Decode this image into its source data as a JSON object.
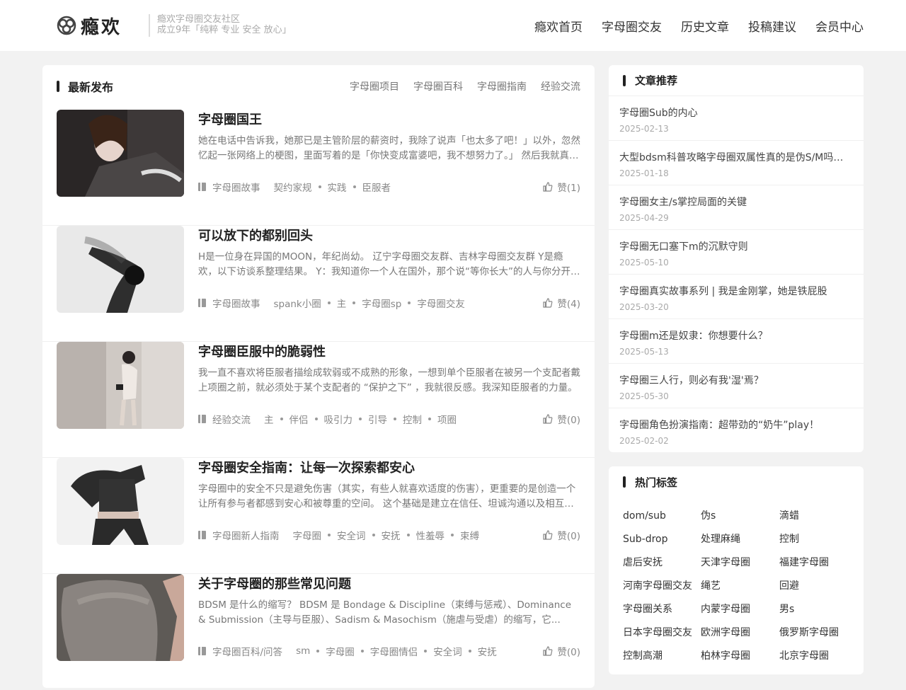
{
  "header": {
    "logo_text": "瘾欢",
    "tagline_line1": "瘾欢字母圈交友社区",
    "tagline_line2": "成立9年「纯粹 专业 安全 放心」",
    "nav": [
      "瘾欢首页",
      "字母圈交友",
      "历史文章",
      "投稿建议",
      "会员中心"
    ]
  },
  "latest": {
    "title": "最新发布",
    "tabs": [
      "字母圈项目",
      "字母圈百科",
      "字母圈指南",
      "经验交流"
    ],
    "posts": [
      {
        "title": "字母圈国王",
        "desc": "她在电话中告诉我，她那已是主管阶层的薪资时，我除了说声「也太多了吧！」以外，忽然忆起一张网络上的梗图，里面写着的是「你快变成富婆吧，我不想努力了。」 然后我就真的觉得自己可以不用努力了。",
        "category": "字母圈故事",
        "tags": [
          "契约家规",
          "实践",
          "臣服者"
        ],
        "likes": "赞(1)"
      },
      {
        "title": "可以放下的都别回头",
        "desc": "H是一位身在异国的MOON，年纪尚幼。 辽宁字母圈交友群、吉林字母圈交友群 Y是瘾欢，以下访谈系整理结果。 Y：我知道你一个人在国外，那个说“等你长大”的人与你分开了。",
        "category": "字母圈故事",
        "tags": [
          "spank小圈",
          "主",
          "字母圈sp",
          "字母圈交友"
        ],
        "likes": "赞(4)"
      },
      {
        "title": "字母圈臣服中的脆弱性",
        "desc": "我一直不喜欢将臣服者描绘成软弱或不成熟的形象，一想到单个臣服者在被另一个支配者戴上项圈之前，就必须处于某个支配者的 “保护之下” ，我就很反感。我深知臣服者的力量。",
        "category": "经验交流",
        "tags": [
          "主",
          "伴侣",
          "吸引力",
          "引导",
          "控制",
          "项圈"
        ],
        "likes": "赞(0)"
      },
      {
        "title": "字母圈安全指南：让每一次探索都安心",
        "desc": "字母圈中的安全不只是避免伤害（其实，有些人就喜欢适度的伤害），更重要的是创造一个让所有参与者都感到安心和被尊重的空间。 这个基础是建立在信任、坦诚沟通以及相互尊重之上的。",
        "category": "字母圈新人指南",
        "tags": [
          "字母圈",
          "安全词",
          "安抚",
          "性羞辱",
          "束缚"
        ],
        "likes": "赞(0)"
      },
      {
        "title": "关于字母圈的那些常见问题",
        "desc": "BDSM 是什么的缩写？ BDSM 是 Bondage & Discipline（束缚与惩戒）、Dominance & Submission（主导与臣服）、Sadism & Masochism（施虐与受虐）的缩写，它...",
        "category": "字母圈百科/问答",
        "tags": [
          "sm",
          "字母圈",
          "字母圈情侣",
          "安全词",
          "安抚"
        ],
        "likes": "赞(0)"
      }
    ]
  },
  "recommend": {
    "title": "文章推荐",
    "items": [
      {
        "title": "字母圈Sub的内心",
        "date": "2025-02-13"
      },
      {
        "title": "大型bdsm科普攻略字母圈双属性真的是伪S/M吗？！",
        "date": "2025-01-18"
      },
      {
        "title": "字母圈女主/s掌控局面的关键",
        "date": "2025-04-29"
      },
      {
        "title": "字母圈无口塞下m的沉默守则",
        "date": "2025-05-10"
      },
      {
        "title": "字母圈真实故事系列 | 我是金刚掌，她是铁屁股",
        "date": "2025-03-20"
      },
      {
        "title": "字母圈m还是奴隶：你想要什么？",
        "date": "2025-05-13"
      },
      {
        "title": "字母圈三人行，则必有我'湿'焉？",
        "date": "2025-05-30"
      },
      {
        "title": "字母圈角色扮演指南：超带劲的“奶牛”play！",
        "date": "2025-02-02"
      }
    ]
  },
  "hot_tags": {
    "title": "热门标签",
    "tags": [
      "dom/sub",
      "伪s",
      "滴蜡",
      "Sub-drop",
      "处理麻绳",
      "控制",
      "虐后安抚",
      "天津字母圈",
      "福建字母圈",
      "河南字母圈交友",
      "绳艺",
      "回避",
      "字母圈关系",
      "内蒙字母圈",
      "男s",
      "日本字母圈交友",
      "欧洲字母圈",
      "俄罗斯字母圈",
      "控制高潮",
      "柏林字母圈",
      "北京字母圈"
    ]
  }
}
